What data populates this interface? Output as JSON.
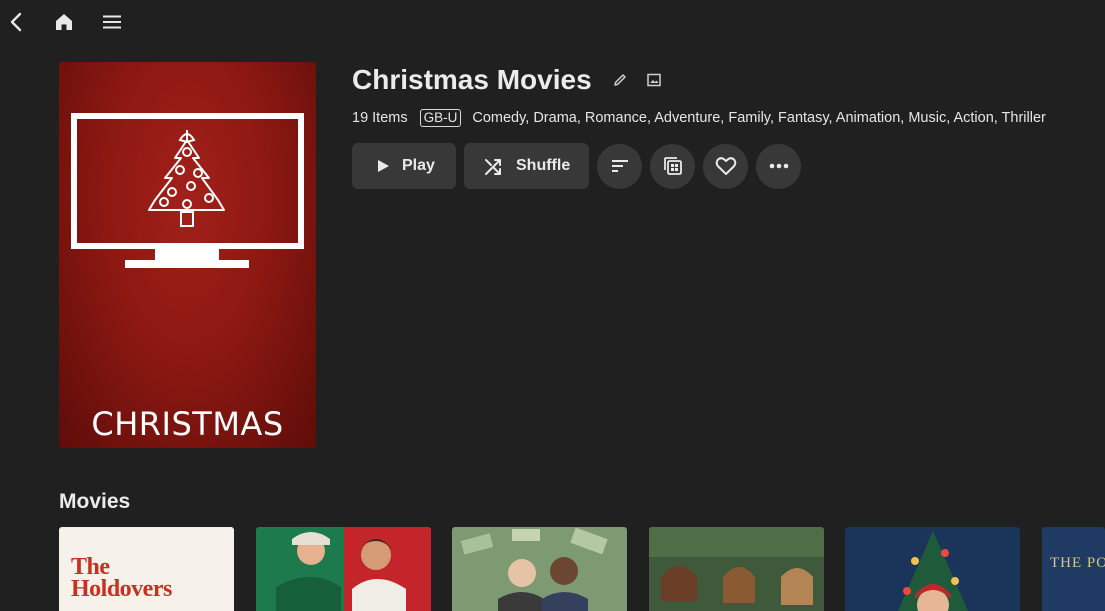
{
  "topbar": {
    "back_icon": "chevron-left-icon",
    "home_icon": "home-icon",
    "menu_icon": "hamburger-menu-icon"
  },
  "poster": {
    "label": "CHRISTMAS",
    "background": "#8d1812",
    "icon": "tv-christmas-tree-icon"
  },
  "collection": {
    "title": "Christmas Movies",
    "item_count": "19 Items",
    "rating": "GB-U",
    "genres": "Comedy, Drama, Romance, Adventure, Family, Fantasy, Animation, Music, Action, Thriller"
  },
  "actions": {
    "play_label": "Play",
    "shuffle_label": "Shuffle",
    "icons": [
      "play-icon",
      "shuffle-icon",
      "sort-icon",
      "collection-icon",
      "heart-icon",
      "more-icon",
      "edit-icon",
      "image-icon"
    ]
  },
  "section": {
    "title": "Movies",
    "items": [
      {
        "title_text": "The Holdovers"
      },
      {
        "title_text": ""
      },
      {
        "title_text": ""
      },
      {
        "title_text": ""
      },
      {
        "title_text": ""
      },
      {
        "title_text": "THE PO"
      }
    ]
  },
  "colors": {
    "background": "#202020",
    "button": "#383838",
    "text": "#eaeaea"
  }
}
